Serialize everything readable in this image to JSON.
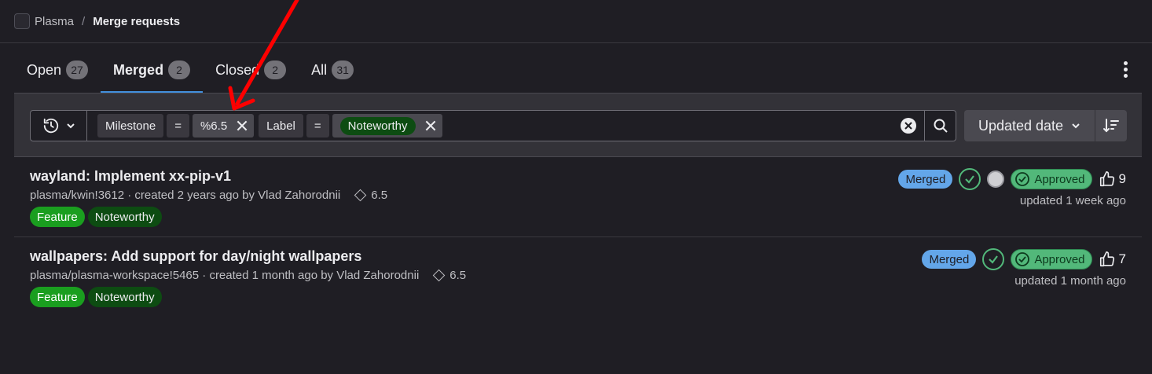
{
  "breadcrumb": {
    "project": "Plasma",
    "separator": "/",
    "current": "Merge requests"
  },
  "tabs": [
    {
      "label": "Open",
      "count": "27"
    },
    {
      "label": "Merged",
      "count": "2"
    },
    {
      "label": "Closed",
      "count": "2"
    },
    {
      "label": "All",
      "count": "31"
    }
  ],
  "filter": {
    "tokens": [
      {
        "field": "Milestone",
        "operator": "=",
        "value": "%6.5"
      },
      {
        "field": "Label",
        "operator": "=",
        "value": "Noteworthy"
      }
    ],
    "sort_label": "Updated date"
  },
  "merge_requests": [
    {
      "title": "wayland: Implement xx-pip-v1",
      "ref": "plasma/kwin!3612",
      "created": " · created 2 years ago by Vlad Zahorodnii",
      "milestone": "6.5",
      "labels": [
        "Feature",
        "Noteworthy"
      ],
      "status": "Merged",
      "approval": "Approved",
      "upvotes": "9",
      "updated": "updated 1 week ago"
    },
    {
      "title": "wallpapers: Add support for day/night wallpapers",
      "ref": "plasma/plasma-workspace!5465",
      "created": " · created 1 month ago by Vlad Zahorodnii",
      "milestone": "6.5",
      "labels": [
        "Feature",
        "Noteworthy"
      ],
      "status": "Merged",
      "approval": "Approved",
      "upvotes": "7",
      "updated": "updated 1 month ago"
    }
  ],
  "colors": {
    "accent": "#428fdc",
    "merged": "#63a6e9",
    "approved": "#52b87a",
    "annotation_arrow": "#ff0000"
  }
}
